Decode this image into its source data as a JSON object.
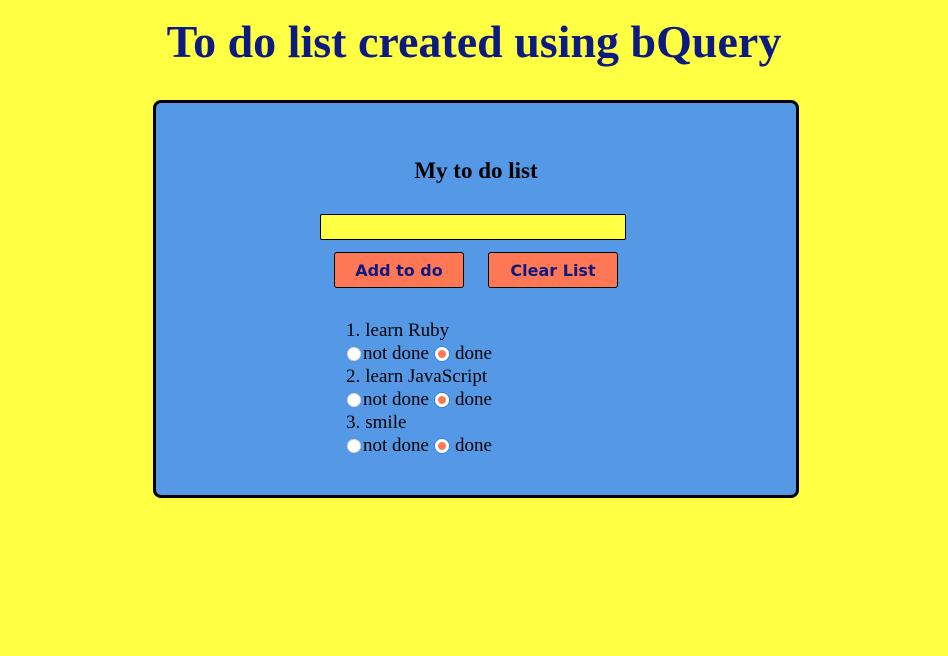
{
  "page": {
    "title": "To do list created using bQuery"
  },
  "panel": {
    "title": "My to do list",
    "input": {
      "value": "",
      "placeholder": ""
    },
    "buttons": {
      "add_label": "Add to do",
      "clear_label": "Clear List"
    },
    "todos": [
      {
        "number": "1.",
        "text": "learn Ruby",
        "not_done_label": "not done",
        "done_label": "done",
        "selected": "done"
      },
      {
        "number": "2.",
        "text": "learn JavaScript",
        "not_done_label": "not done",
        "done_label": "done",
        "selected": "done"
      },
      {
        "number": "3.",
        "text": "smile",
        "not_done_label": "not done",
        "done_label": "done",
        "selected": "done"
      }
    ]
  },
  "colors": {
    "page_background": "#ffff44",
    "title_color": "#0d1a80",
    "panel_background": "#5599e6",
    "button_background": "#ff7755",
    "input_background": "#ffff44",
    "radio_selected": "#ff7755"
  }
}
